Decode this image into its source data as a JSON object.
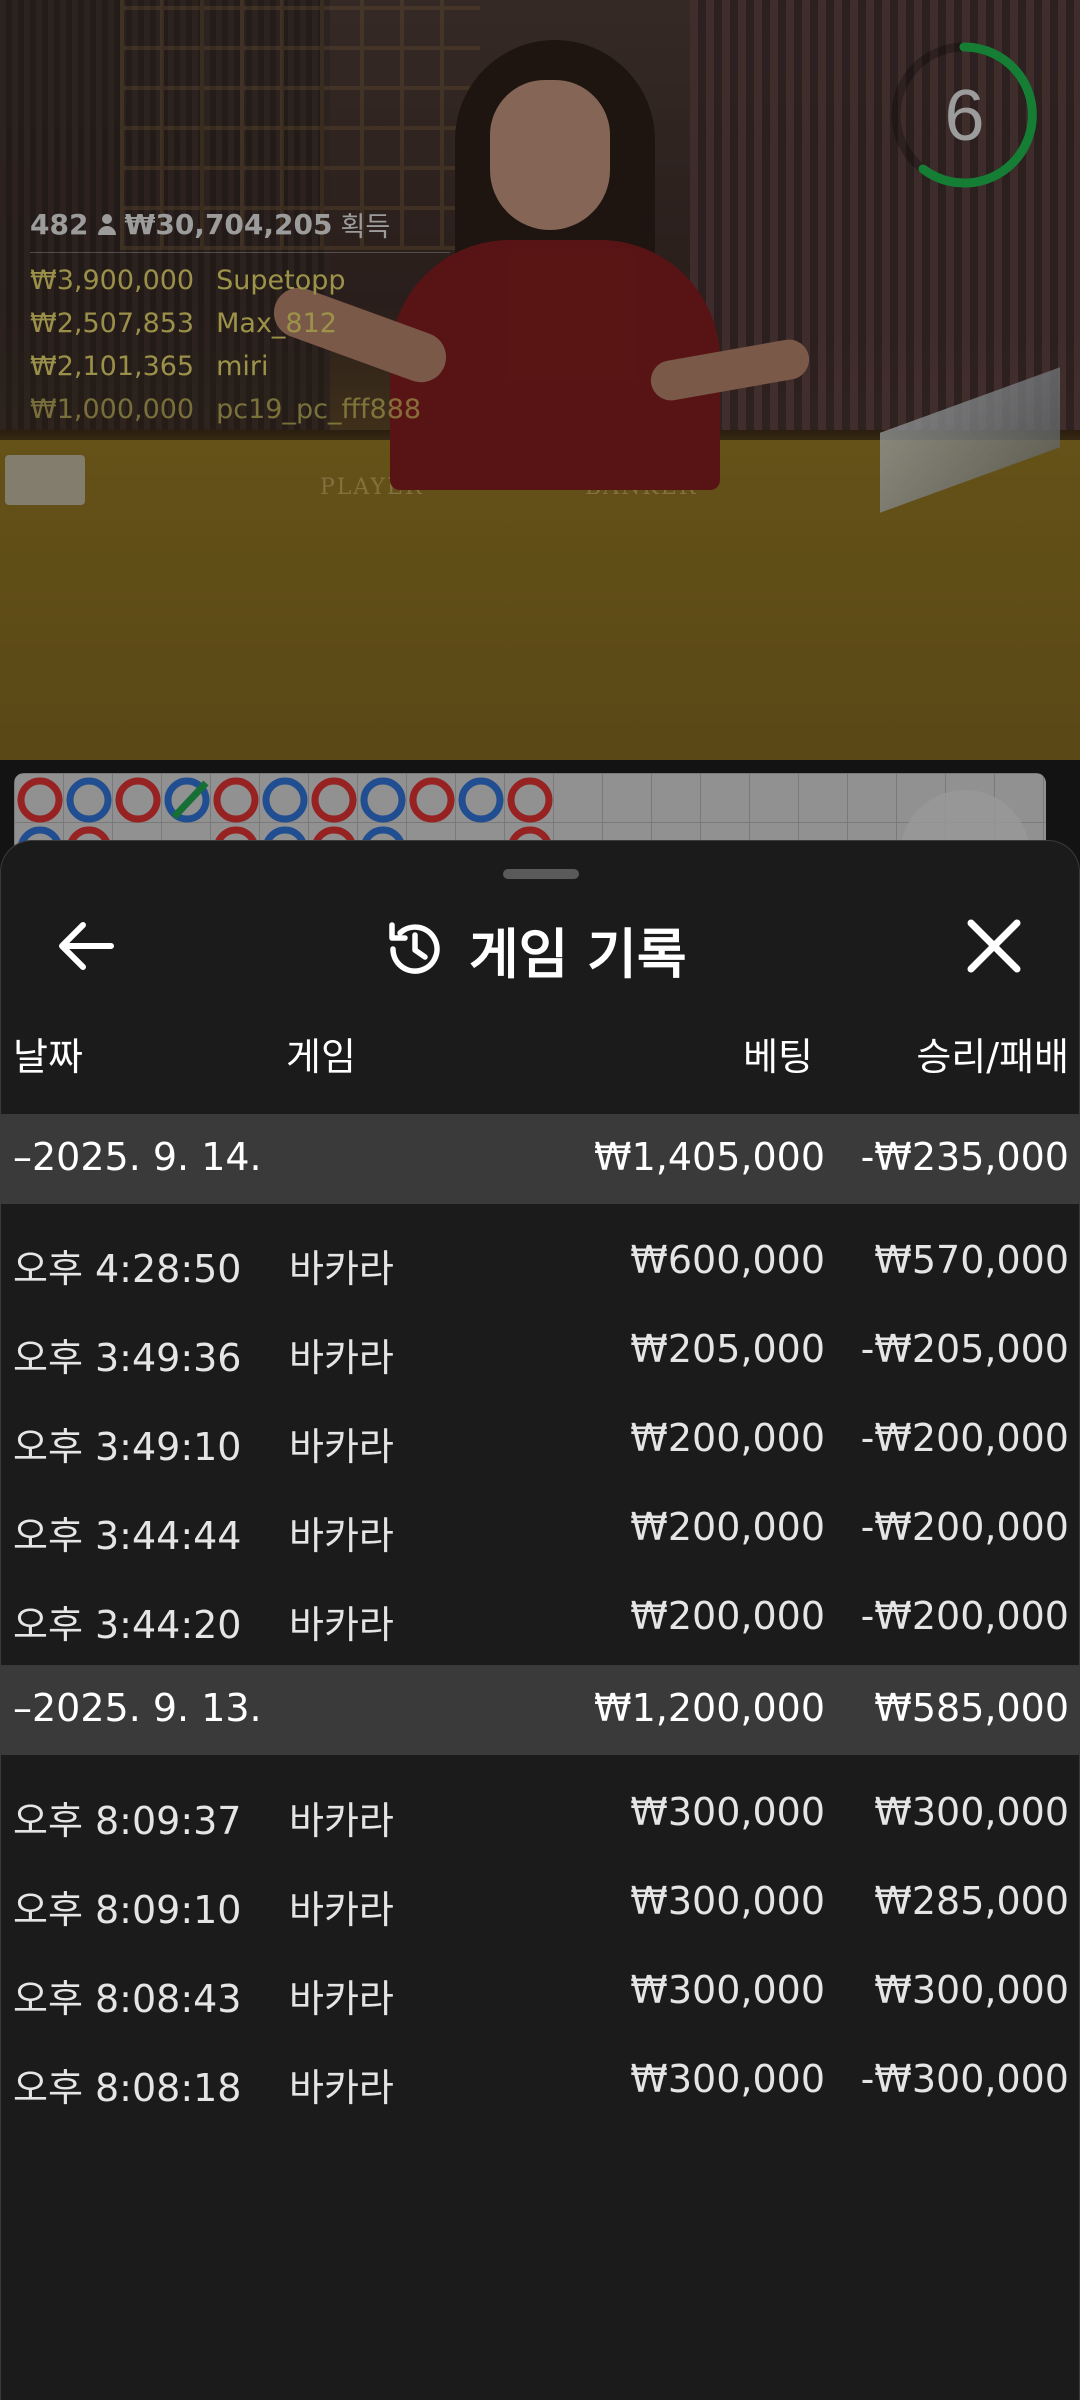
{
  "video": {
    "countdown": "6",
    "table_labels": {
      "player": "PLAYER",
      "banker": "BANKER"
    },
    "winners": {
      "count": "482",
      "total": "₩30,704,205",
      "suffix": "획득",
      "list": [
        {
          "amount": "₩3,900,000",
          "name": "Supetopp"
        },
        {
          "amount": "₩2,507,853",
          "name": "Max_812"
        },
        {
          "amount": "₩2,101,365",
          "name": "miri"
        },
        {
          "amount": "₩1,000,000",
          "name": "pc19_pc_fff888"
        }
      ]
    },
    "colors": {
      "banker_red": "#d0302e",
      "player_blue": "#2f6cc9",
      "tie_green": "#1f9a49",
      "timer_green": "#1fae4a"
    }
  },
  "sheet": {
    "title": "게임 기록",
    "icons": {
      "back": "arrow-left-icon",
      "title": "history-icon",
      "close": "close-icon"
    },
    "columns": {
      "date": "날짜",
      "game": "게임",
      "bet": "베팅",
      "win_loss": "승리/패배"
    },
    "groups": [
      {
        "date": "–2025. 9. 14.",
        "total_bet": "₩1,405,000",
        "total_result": "-₩235,000",
        "rows": [
          {
            "time": "오후 4:28:50",
            "game": "바카라",
            "bet": "₩600,000",
            "result": "₩570,000"
          },
          {
            "time": "오후 3:49:36",
            "game": "바카라",
            "bet": "₩205,000",
            "result": "-₩205,000"
          },
          {
            "time": "오후 3:49:10",
            "game": "바카라",
            "bet": "₩200,000",
            "result": "-₩200,000"
          },
          {
            "time": "오후 3:44:44",
            "game": "바카라",
            "bet": "₩200,000",
            "result": "-₩200,000"
          },
          {
            "time": "오후 3:44:20",
            "game": "바카라",
            "bet": "₩200,000",
            "result": "-₩200,000"
          }
        ]
      },
      {
        "date": "–2025. 9. 13.",
        "total_bet": "₩1,200,000",
        "total_result": "₩585,000",
        "rows": [
          {
            "time": "오후 8:09:37",
            "game": "바카라",
            "bet": "₩300,000",
            "result": "₩300,000"
          },
          {
            "time": "오후 8:09:10",
            "game": "바카라",
            "bet": "₩300,000",
            "result": "₩285,000"
          },
          {
            "time": "오후 8:08:43",
            "game": "바카라",
            "bet": "₩300,000",
            "result": "₩300,000"
          },
          {
            "time": "오후 8:08:18",
            "game": "바카라",
            "bet": "₩300,000",
            "result": "-₩300,000"
          }
        ]
      }
    ]
  }
}
